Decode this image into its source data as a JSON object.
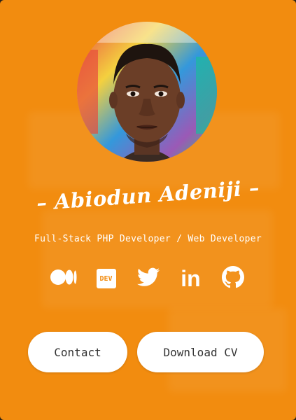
{
  "profile": {
    "name": "– Abiodun Adeniji –",
    "role": "Full-Stack PHP Developer / Web Developer"
  },
  "socials": [
    {
      "icon": "medium-icon"
    },
    {
      "icon": "dev-icon",
      "text": "DEV"
    },
    {
      "icon": "twitter-icon"
    },
    {
      "icon": "linkedin-icon",
      "text": "in"
    },
    {
      "icon": "github-icon"
    }
  ],
  "buttons": {
    "contact": "Contact",
    "download_cv": "Download CV"
  },
  "colors": {
    "background": "#f28c0f",
    "button_bg": "#ffffff",
    "text": "#ffffff"
  }
}
